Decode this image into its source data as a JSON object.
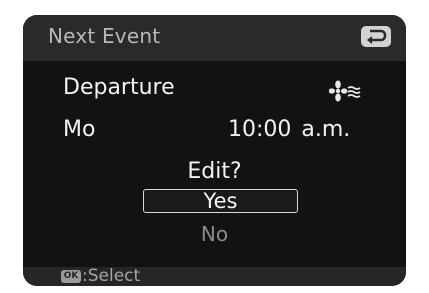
{
  "header": {
    "title": "Next Event",
    "back_icon": "return-arrow-icon"
  },
  "event": {
    "name": "Departure",
    "mode_icon": "fan-wind-icon",
    "day": "Mo",
    "time": "10:00 a.m."
  },
  "dialog": {
    "prompt": "Edit?",
    "options": [
      {
        "label": "Yes",
        "selected": true
      },
      {
        "label": "No",
        "selected": false
      }
    ]
  },
  "footer": {
    "button_icon": "ok-button-icon",
    "button_label": "OK",
    "action_text": ":Select"
  },
  "colors": {
    "screen_background": "#121212",
    "header_background": "#2a2a2a",
    "text_primary": "#f2f2f2",
    "text_dimmed": "#8a8a8a"
  }
}
